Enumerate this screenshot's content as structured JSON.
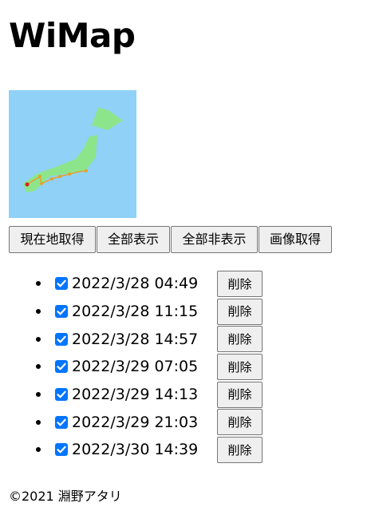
{
  "header": {
    "title": "WiMap"
  },
  "map": {
    "sea_color": "#8fd1f7",
    "land_color": "#8de58b",
    "track_color": "#e5a22b",
    "current_marker_color": "#d82020"
  },
  "toolbar": {
    "get_location_label": "現在地取得",
    "show_all_label": "全部表示",
    "hide_all_label": "全部非表示",
    "get_image_label": "画像取得"
  },
  "points": [
    {
      "timestamp": "2022/3/28 04:49",
      "checked": true,
      "delete_label": "削除"
    },
    {
      "timestamp": "2022/3/28 11:15",
      "checked": true,
      "delete_label": "削除"
    },
    {
      "timestamp": "2022/3/28 14:57",
      "checked": true,
      "delete_label": "削除"
    },
    {
      "timestamp": "2022/3/29 07:05",
      "checked": true,
      "delete_label": "削除"
    },
    {
      "timestamp": "2022/3/29 14:13",
      "checked": true,
      "delete_label": "削除"
    },
    {
      "timestamp": "2022/3/29 21:03",
      "checked": true,
      "delete_label": "削除"
    },
    {
      "timestamp": "2022/3/30 14:39",
      "checked": true,
      "delete_label": "削除"
    }
  ],
  "footer": {
    "copyright": "©2021 淵野アタリ"
  }
}
